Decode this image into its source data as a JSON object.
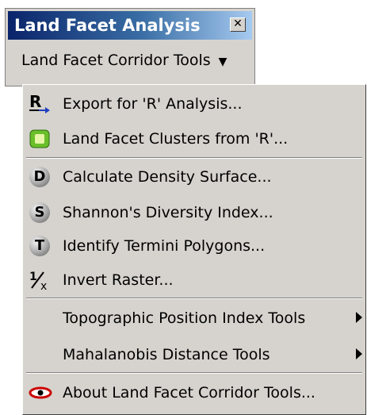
{
  "toolbar": {
    "title": "Land Facet Analysis",
    "close_glyph": "✕",
    "dropdown_label": "Land Facet Corridor Tools",
    "dropdown_arrow": "▼"
  },
  "menu": {
    "items": [
      {
        "label": "Export for 'R' Analysis...",
        "icon": "r-export-icon"
      },
      {
        "label": "Land Facet Clusters from 'R'...",
        "icon": "clusters-icon"
      },
      {
        "label": "Calculate Density Surface...",
        "icon": "d-icon",
        "letter": "D"
      },
      {
        "label": "Shannon's Diversity Index...",
        "icon": "s-icon",
        "letter": "S"
      },
      {
        "label": "Identify Termini Polygons...",
        "icon": "t-icon",
        "letter": "T"
      },
      {
        "label": "Invert Raster...",
        "icon": "invert-icon"
      },
      {
        "label": "Topographic Position Index Tools",
        "submenu": true
      },
      {
        "label": "Mahalanobis Distance Tools",
        "submenu": true
      },
      {
        "label": "About Land Facet Corridor Tools...",
        "icon": "eye-icon"
      }
    ]
  },
  "colors": {
    "title_bar_start": "#0a246a",
    "title_bar_end": "#a6caf0",
    "face": "#d6d3ce"
  }
}
